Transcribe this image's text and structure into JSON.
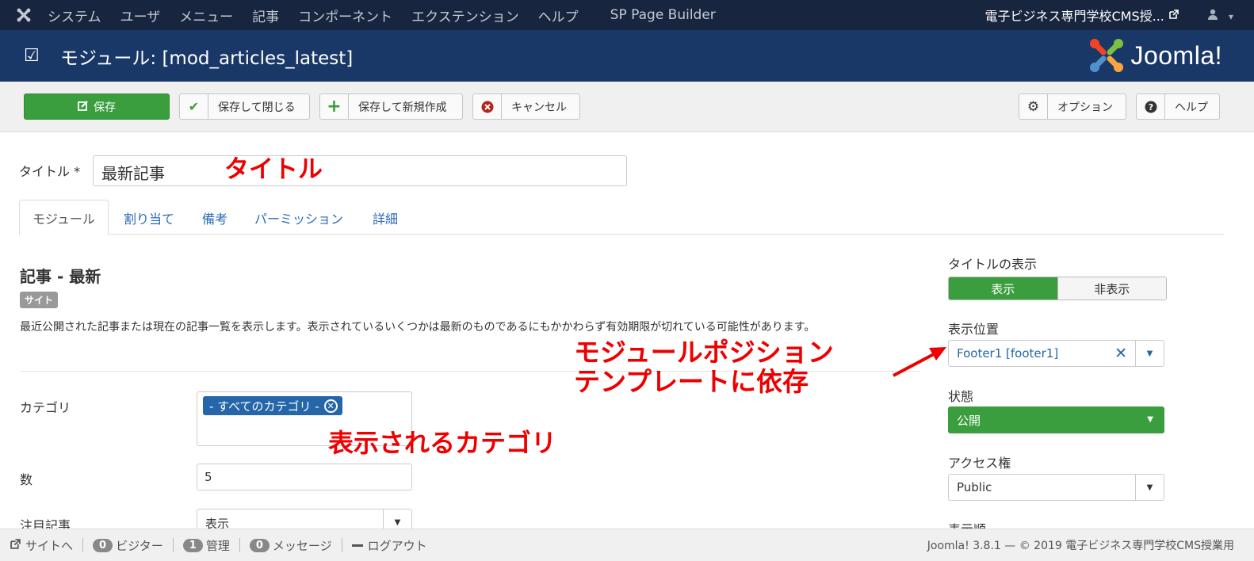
{
  "topnav": {
    "menu": [
      "システム",
      "ユーザ",
      "メニュー",
      "記事",
      "コンポーネント",
      "エクステンション",
      "ヘルプ",
      "SP Page Builder"
    ],
    "site_name": "電子ビジネス専門学校CMS授...",
    "user_caret": "▾"
  },
  "header": {
    "title": "モジュール: [mod_articles_latest]",
    "brand": "Joomla!"
  },
  "toolbar": {
    "save": "保存",
    "save_close": "保存して閉じる",
    "save_new": "保存して新規作成",
    "cancel": "キャンセル",
    "options": "オプション",
    "help": "ヘルプ"
  },
  "form": {
    "title_label": "タイトル *",
    "title_value": "最新記事"
  },
  "annotations": {
    "title": "タイトル",
    "position_1": "モジュールポジション",
    "position_2": "テンプレートに依存",
    "category": "表示されるカテゴリ"
  },
  "tabs": [
    "モジュール",
    "割り当て",
    "備考",
    "パーミッション",
    "詳細"
  ],
  "module": {
    "heading": "記事 - 最新",
    "badge": "サイト",
    "description": "最近公開された記事または現在の記事一覧を表示します。表示されているいくつかは最新のものであるにもかかわらず有効期限が切れている可能性があります。"
  },
  "fields": {
    "category_label": "カテゴリ",
    "category_chip": "- すべてのカテゴリ -",
    "count_label": "数",
    "count_value": "5",
    "featured_label": "注目記事",
    "featured_value": "表示"
  },
  "sidebar": {
    "show_title_label": "タイトルの表示",
    "show_on": "表示",
    "show_off": "非表示",
    "position_label": "表示位置",
    "position_value": "Footer1 [footer1]",
    "status_label": "状態",
    "status_value": "公開",
    "access_label": "アクセス権",
    "access_value": "Public",
    "order_label": "表示順"
  },
  "footer": {
    "site": "サイトへ",
    "visitors_count": "0",
    "visitors": "ビジター",
    "admin_count": "1",
    "admin": "管理",
    "messages_count": "0",
    "messages": "メッセージ",
    "logout": "ログアウト",
    "copyright": "Joomla! 3.8.1 — © 2019 電子ビジネス専門学校CMS授業用"
  },
  "colors": {
    "nav_bg": "#17253f",
    "header_bg": "#1a3867",
    "green": "#3a9e3e",
    "link": "#2466a8",
    "annotation": "#e00000"
  }
}
